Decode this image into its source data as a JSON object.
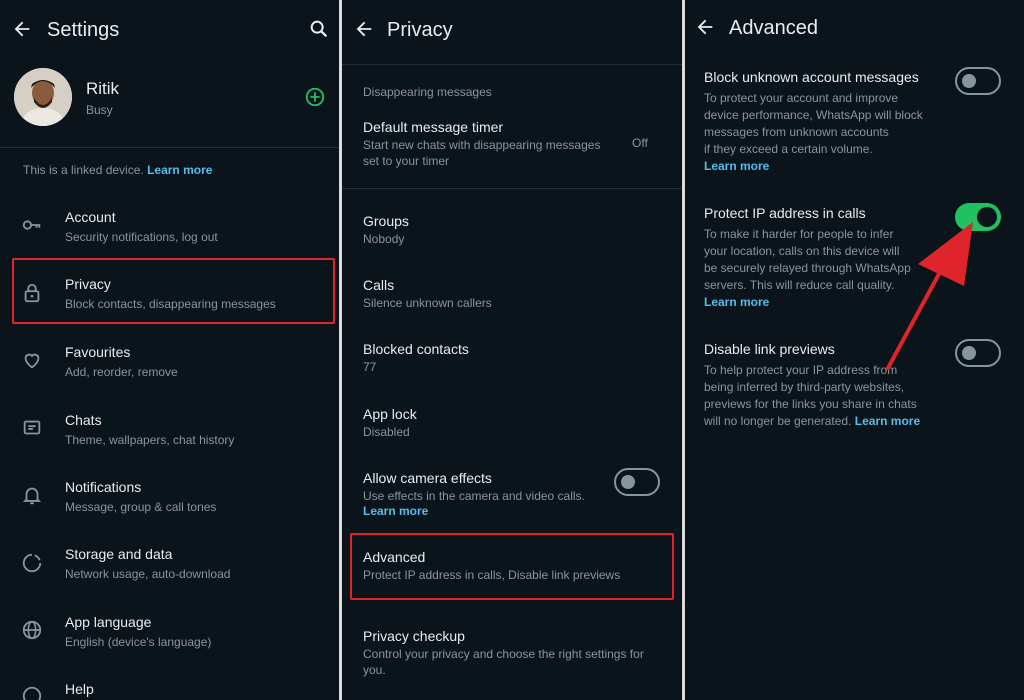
{
  "settings": {
    "title": "Settings",
    "profile": {
      "name": "Ritik",
      "status": "Busy"
    },
    "linked_text": "This is a linked device.",
    "learn_more": "Learn more",
    "items": [
      {
        "title": "Account",
        "sub": "Security notifications, log out"
      },
      {
        "title": "Privacy",
        "sub": "Block contacts, disappearing messages"
      },
      {
        "title": "Favourites",
        "sub": "Add, reorder, remove"
      },
      {
        "title": "Chats",
        "sub": "Theme, wallpapers, chat history"
      },
      {
        "title": "Notifications",
        "sub": "Message, group & call tones"
      },
      {
        "title": "Storage and data",
        "sub": "Network usage, auto-download"
      },
      {
        "title": "App language",
        "sub": "English (device's language)"
      },
      {
        "title": "Help",
        "sub": ""
      }
    ]
  },
  "privacy": {
    "title": "Privacy",
    "section": "Disappearing messages",
    "timer": {
      "title": "Default message timer",
      "sub1": "Start new chats with disappearing messages",
      "sub2": "set to your timer",
      "value": "Off"
    },
    "items": [
      {
        "title": "Groups",
        "sub": "Nobody"
      },
      {
        "title": "Calls",
        "sub": "Silence unknown callers"
      },
      {
        "title": "Blocked contacts",
        "sub": "77"
      },
      {
        "title": "App lock",
        "sub": "Disabled"
      }
    ],
    "camera": {
      "title": "Allow camera effects",
      "sub": "Use effects in the camera and video calls.",
      "link": "Learn more",
      "enabled": false
    },
    "advanced": {
      "title": "Advanced",
      "sub": "Protect IP address in calls, Disable link previews"
    },
    "checkup": {
      "title": "Privacy checkup",
      "sub1": "Control your privacy and choose the right settings for",
      "sub2": "you."
    }
  },
  "advanced": {
    "title": "Advanced",
    "block": {
      "title": "Block unknown account messages",
      "lines": [
        "To protect your account and improve",
        "device performance, WhatsApp will block",
        "messages from unknown accounts",
        "if they exceed a certain volume."
      ],
      "link": "Learn more",
      "enabled": false
    },
    "protect": {
      "title": "Protect IP address in calls",
      "lines": [
        "To make it harder for people to infer",
        "your location, calls on this device will",
        "be securely relayed through WhatsApp",
        "servers. This will reduce call quality."
      ],
      "link": "Learn more",
      "enabled": true
    },
    "disable": {
      "title": "Disable link previews",
      "lines": [
        "To help protect your IP address from",
        "being inferred by third-party websites,",
        "previews for the links you share in chats"
      ],
      "last_line": "will no longer be generated.",
      "link": "Learn more",
      "enabled": false
    }
  },
  "colors": {
    "accent": "#21c063",
    "link": "#53bdeb",
    "highlight": "#e0242b",
    "background": "#0b141a"
  }
}
